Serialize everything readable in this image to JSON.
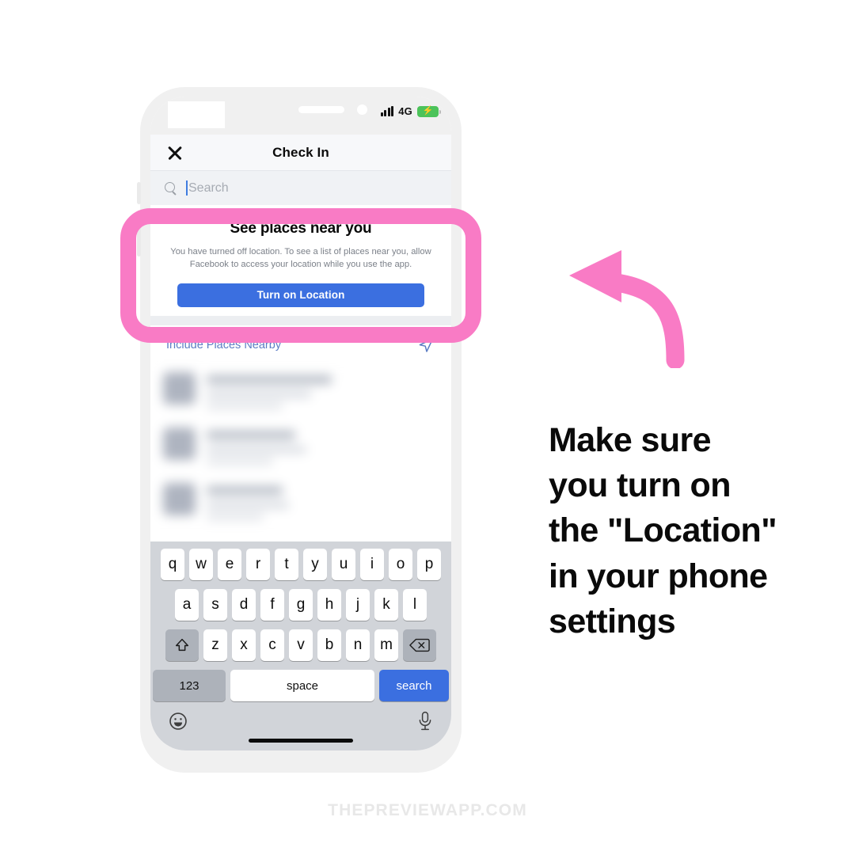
{
  "status_bar": {
    "network_label": "4G",
    "signal_icon": "signal-bars-icon",
    "battery_icon": "battery-charging-icon",
    "battery_bolt": "⚡",
    "battery_color": "#4cc35a"
  },
  "nav": {
    "close_icon": "close-x-icon",
    "title": "Check In"
  },
  "search": {
    "icon": "search-icon",
    "placeholder": "Search",
    "value": "",
    "caret_color": "#3f7ce0"
  },
  "near_card": {
    "title": "See places near you",
    "description": "You have turned off location. To see a list of places near you, allow Facebook to access your location while you use the app.",
    "button_label": "Turn on Location",
    "button_color": "#3b6fe0"
  },
  "include_row": {
    "label": "Include Places Nearby",
    "icon": "navigation-arrow-icon",
    "label_color": "#5c7cc4"
  },
  "results": [
    {
      "name_width": 158,
      "sub_width": 132,
      "sub2_width": 96
    },
    {
      "name_width": 112,
      "sub_width": 126,
      "sub2_width": 84
    },
    {
      "name_width": 96,
      "sub_width": 104,
      "sub2_width": 72
    }
  ],
  "keyboard": {
    "row1": [
      "q",
      "w",
      "e",
      "r",
      "t",
      "y",
      "u",
      "i",
      "o",
      "p"
    ],
    "row2": [
      "a",
      "s",
      "d",
      "f",
      "g",
      "h",
      "j",
      "k",
      "l"
    ],
    "row3": [
      "z",
      "x",
      "c",
      "v",
      "b",
      "n",
      "m"
    ],
    "shift_icon": "shift-arrow-icon",
    "backspace_icon": "backspace-delete-icon",
    "numeric_label": "123",
    "space_label": "space",
    "search_label": "search",
    "search_key_color": "#3b6fe0",
    "emoji_icon": "emoji-smiley-icon",
    "mic_icon": "microphone-icon",
    "home_indicator": "home-indicator-bar"
  },
  "annotation": {
    "highlight_color": "#f97bc5",
    "arrow_icon": "curved-arrow-left-icon",
    "text_line1": "Make sure",
    "text_line2": "you turn on",
    "text_line3": "the \"Location\"",
    "text_line4": "in your phone",
    "text_line5": "settings"
  },
  "watermark": {
    "text": "THEPREVIEWAPP.COM"
  }
}
